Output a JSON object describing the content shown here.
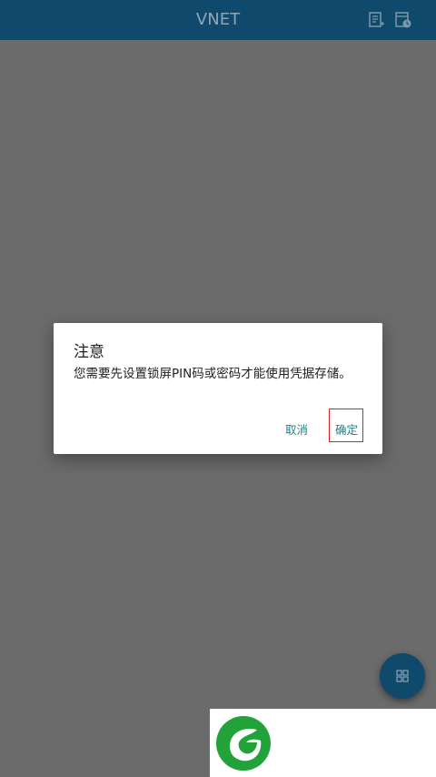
{
  "app_bar": {
    "title": "VNET",
    "actions": [
      {
        "icon": "note-add-icon"
      },
      {
        "icon": "calendar-clock-icon"
      }
    ],
    "color": "#0f4a6d"
  },
  "dialog": {
    "title": "注意",
    "message": "您需要先设置锁屏PIN码或密码才能使用凭据存储。",
    "buttons": {
      "cancel": "取消",
      "confirm": "确定"
    },
    "accent_color": "#2a7f86"
  },
  "fab": {
    "icon": "grid-icon"
  },
  "overlay_color": "#6b6b6b",
  "highlight_color": "#e02020",
  "watermark": {
    "icon": "green-leaf-logo-icon"
  }
}
